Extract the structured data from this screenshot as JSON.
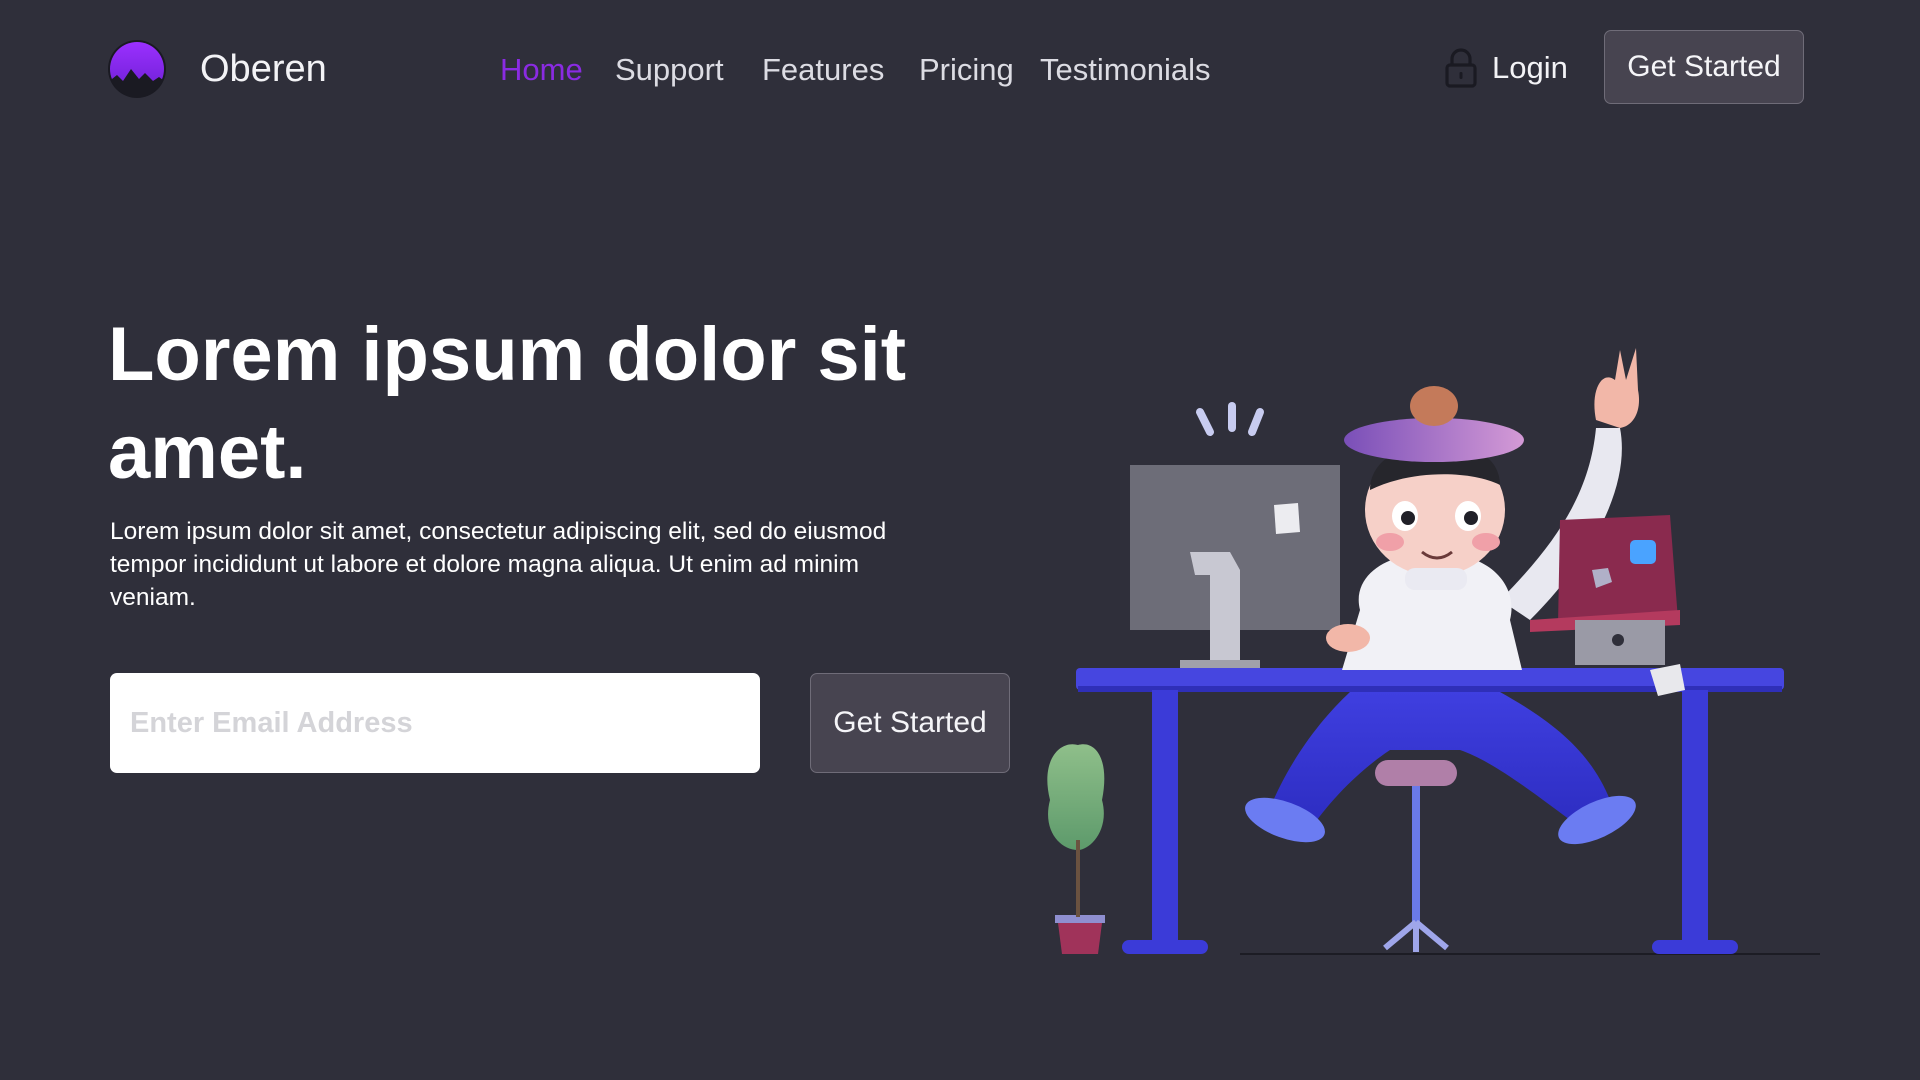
{
  "brand": {
    "name": "Oberen",
    "logo_icon": "mountain-circle-logo-icon",
    "accent": "#8a2be2"
  },
  "nav": {
    "links": [
      {
        "label": "Home",
        "active": true
      },
      {
        "label": "Support",
        "active": false
      },
      {
        "label": "Features",
        "active": false
      },
      {
        "label": "Pricing",
        "active": false
      },
      {
        "label": "Testimonials",
        "active": false
      }
    ],
    "login_label": "Login",
    "login_icon": "lock-icon",
    "cta_label": "Get Started"
  },
  "hero": {
    "title": "Lorem ipsum dolor sit amet.",
    "text": "Lorem ipsum dolor sit amet, consectetur adipiscing elit, sed do eiusmod tempor incididunt ut labore et dolore magna aliqua. Ut enim ad minim veniam.",
    "email_placeholder": "Enter Email Address",
    "email_value": "",
    "cta_label": "Get Started"
  },
  "colors": {
    "background": "#2f2f3a",
    "button_bg": "#474450",
    "active_link": "#8a2be2",
    "desk": "#3e3fd6"
  }
}
